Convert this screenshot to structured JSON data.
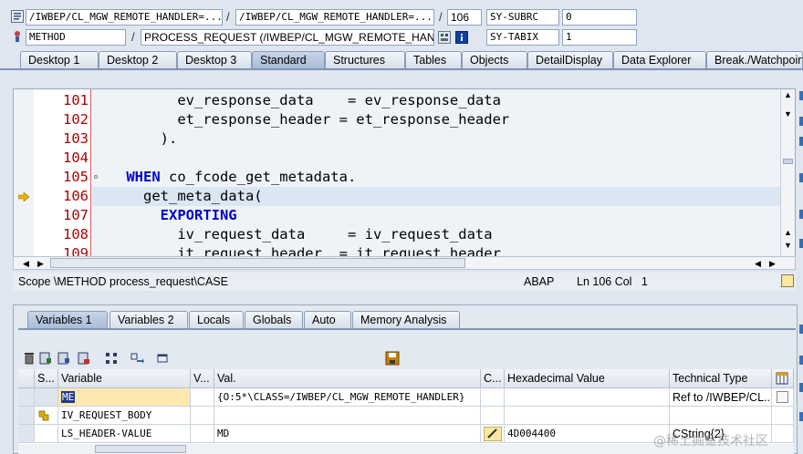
{
  "header": {
    "row1": {
      "program": "/IWBEP/CL_MGW_REMOTE_HANDLER=...",
      "include": "/IWBEP/CL_MGW_REMOTE_HANDLER=...",
      "line": "106",
      "sysvar_name": "SY-SUBRC",
      "sysvar_value": "0"
    },
    "row2": {
      "event_type": "METHOD",
      "event": "PROCESS_REQUEST (/IWBEP/CL_MGW_REMOTE_HAND...",
      "sysvar_name": "SY-TABIX",
      "sysvar_value": "1"
    },
    "separator": "/"
  },
  "main_tabs": [
    {
      "label": "Desktop 1"
    },
    {
      "label": "Desktop 2"
    },
    {
      "label": "Desktop 3"
    },
    {
      "label": "Standard",
      "active": true
    },
    {
      "label": "Structures"
    },
    {
      "label": "Tables"
    },
    {
      "label": "Objects"
    },
    {
      "label": "DetailDisplay"
    },
    {
      "label": "Data Explorer"
    },
    {
      "label": "Break./Watchpoints"
    }
  ],
  "code": {
    "lines": [
      {
        "num": "101",
        "text": "          ev_response_data    = ev_response_data"
      },
      {
        "num": "102",
        "text": "          et_response_header = et_response_header"
      },
      {
        "num": "103",
        "text": "        )."
      },
      {
        "num": "104",
        "text": ""
      },
      {
        "num": "105",
        "pre": "    ",
        "kw": "WHEN",
        "text": " co_fcode_get_metadata."
      },
      {
        "num": "106",
        "text": "      get_meta_data(",
        "current": true
      },
      {
        "num": "107",
        "pre": "        ",
        "kw": "EXPORTING",
        "text": ""
      },
      {
        "num": "108",
        "text": "          iv_request_data     = iv_request_data"
      },
      {
        "num": "109",
        "text": "          it_request_header  = it_request_header"
      }
    ]
  },
  "status": {
    "scope": "Scope \\METHOD process_request\\CASE",
    "language": "ABAP",
    "position": "Ln 106 Col   1"
  },
  "var_tabs": [
    {
      "label": "Variables 1",
      "active": true
    },
    {
      "label": "Variables 2"
    },
    {
      "label": "Locals"
    },
    {
      "label": "Globals"
    },
    {
      "label": "Auto"
    },
    {
      "label": "Memory Analysis"
    }
  ],
  "grid": {
    "columns": [
      "S...",
      "Variable",
      "V...",
      "Val.",
      "C...",
      "Hexadecimal Value",
      "Technical Type"
    ],
    "rows": [
      {
        "variable": "ME",
        "value": "{O:5*\\CLASS=/IWBEP/CL_MGW_REMOTE_HANDLER}",
        "hex": "",
        "type": "Ref to /IWBEP/CL...",
        "selected": true
      },
      {
        "variable": "IV_REQUEST_BODY",
        "value": "",
        "hex": "",
        "type": ""
      },
      {
        "variable": "LS_HEADER-VALUE",
        "value": "MD",
        "hex": "4D004400",
        "type": "CString{2}"
      }
    ]
  },
  "watermark": "@稀土掘金技术社区",
  "colors": {
    "line_number": "#b00000",
    "keyword": "#0000d0",
    "accent": "#3a6db3"
  }
}
